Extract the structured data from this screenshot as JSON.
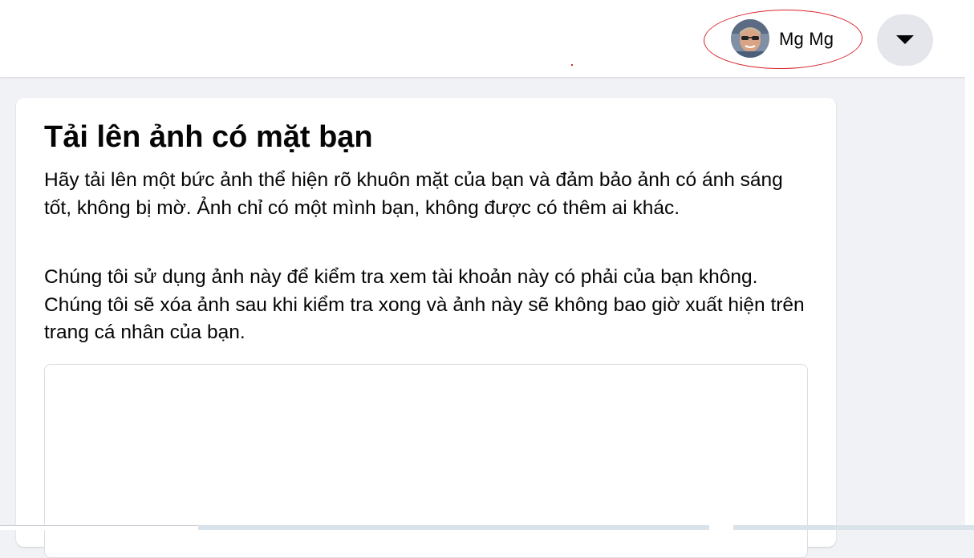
{
  "header": {
    "profile_name": "Mg Mg",
    "avatar_icon": "user-avatar",
    "menu_icon": "caret-down-icon"
  },
  "card": {
    "title": "Tải lên ảnh có mặt bạn",
    "paragraph1": "Hãy tải lên một bức ảnh thể hiện rõ khuôn mặt của bạn và đảm bảo ảnh có ánh sáng tốt, không bị mờ. Ảnh chỉ có một mình bạn, không được có thêm ai khác.",
    "paragraph2": "Chúng tôi sử dụng ảnh này để kiểm tra xem tài khoản này có phải của bạn không. Chúng tôi sẽ xóa ảnh sau khi kiểm tra xong và ảnh này sẽ không bao giờ xuất hiện trên trang cá nhân của bạn."
  },
  "colors": {
    "background": "#f0f2f5",
    "card": "#ffffff",
    "button_bg": "#e4e6eb",
    "annotation": "#d8222a"
  }
}
